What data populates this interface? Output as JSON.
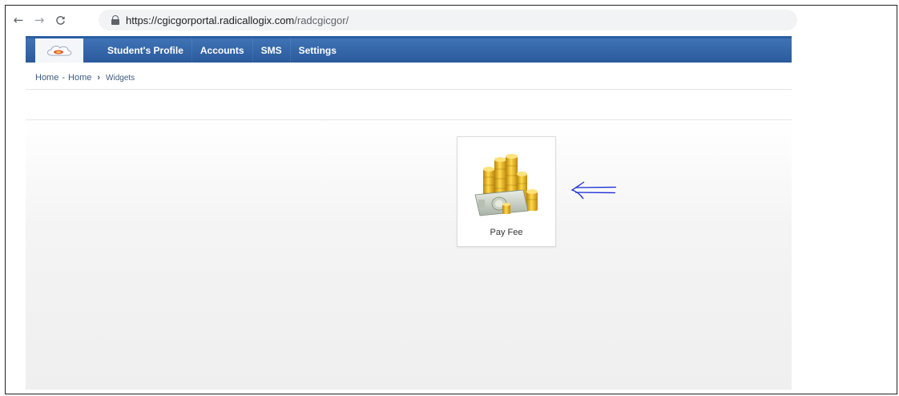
{
  "browser": {
    "back_glyph": "←",
    "forward_glyph": "→",
    "reload_glyph": "C",
    "url_host": "https://cgicgorportal.radicallogix.com",
    "url_path": "/radcgicgor/"
  },
  "nav": {
    "logo_icon": "cloud-logo-icon",
    "items": [
      "Student's Profile",
      "Accounts",
      "SMS",
      "Settings"
    ],
    "accent_color": "#2d5fa3"
  },
  "breadcrumb": {
    "first": "Home",
    "dash": "-",
    "second": "Home",
    "arrow": "›",
    "current": "Widgets"
  },
  "widgets": [
    {
      "label": "Pay Fee",
      "icon": "coins-money-icon"
    }
  ],
  "annotation": {
    "icon": "hand-drawn-arrow-icon",
    "color": "#1a2bd6"
  }
}
